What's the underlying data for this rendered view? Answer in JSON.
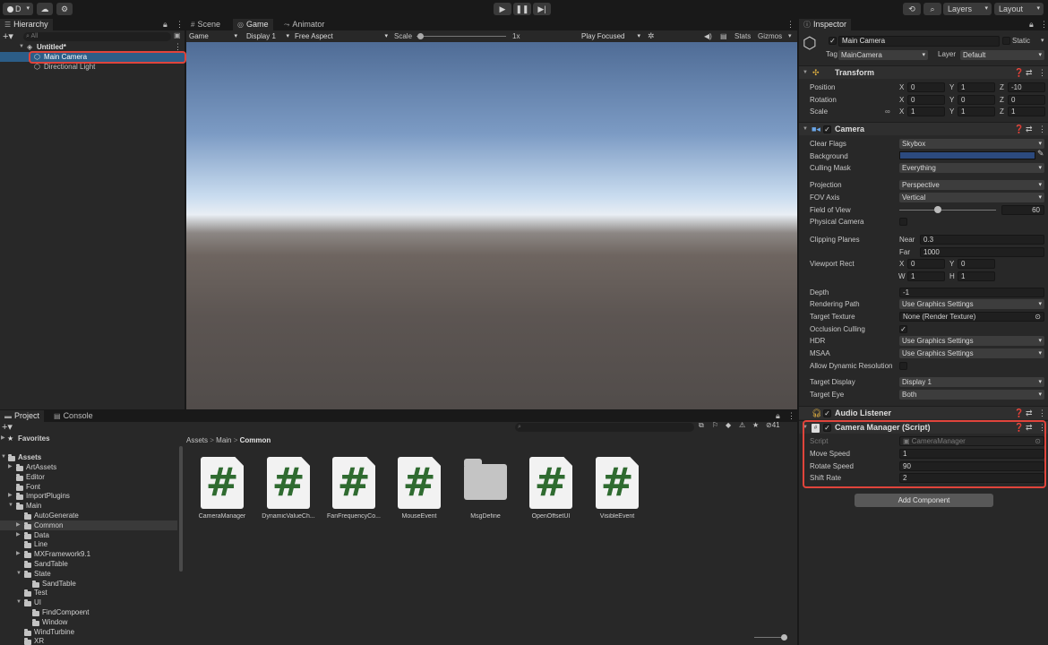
{
  "toolbar": {
    "account_label": "D",
    "layers_label": "Layers",
    "layout_label": "Layout"
  },
  "hierarchy": {
    "tab": "Hierarchy",
    "search_placeholder": "All",
    "scene_name": "Untitled*",
    "items": [
      "Main Camera",
      "Directional Light"
    ]
  },
  "view_tabs": [
    "Scene",
    "Game",
    "Animator"
  ],
  "game_bar": {
    "mode": "Game",
    "display": "Display 1",
    "aspect": "Free Aspect",
    "scale_label": "Scale",
    "scale_value": "1x",
    "play_mode": "Play Focused",
    "stats": "Stats",
    "gizmos": "Gizmos"
  },
  "inspector": {
    "tab": "Inspector",
    "object_name": "Main Camera",
    "static_label": "Static",
    "tag_label": "Tag",
    "tag_value": "MainCamera",
    "layer_label": "Layer",
    "layer_value": "Default",
    "transform": {
      "title": "Transform",
      "position_label": "Position",
      "position": [
        "0",
        "1",
        "-10"
      ],
      "rotation_label": "Rotation",
      "rotation": [
        "0",
        "0",
        "0"
      ],
      "scale_label": "Scale",
      "scale": [
        "1",
        "1",
        "1"
      ]
    },
    "camera": {
      "title": "Camera",
      "clear_flags_label": "Clear Flags",
      "clear_flags": "Skybox",
      "background_label": "Background",
      "background_color": "#2c4a7e",
      "culling_mask_label": "Culling Mask",
      "culling_mask": "Everything",
      "projection_label": "Projection",
      "projection": "Perspective",
      "fov_axis_label": "FOV Axis",
      "fov_axis": "Vertical",
      "fov_label": "Field of View",
      "fov": "60",
      "physical_camera_label": "Physical Camera",
      "clipping_label": "Clipping Planes",
      "near_label": "Near",
      "near": "0.3",
      "far_label": "Far",
      "far": "1000",
      "viewport_label": "Viewport Rect",
      "vp_x": "0",
      "vp_y": "0",
      "vp_w": "1",
      "vp_h": "1",
      "depth_label": "Depth",
      "depth": "-1",
      "rendering_path_label": "Rendering Path",
      "rendering_path": "Use Graphics Settings",
      "target_texture_label": "Target Texture",
      "target_texture": "None (Render Texture)",
      "occlusion_label": "Occlusion Culling",
      "hdr_label": "HDR",
      "hdr": "Use Graphics Settings",
      "msaa_label": "MSAA",
      "msaa": "Use Graphics Settings",
      "dyn_res_label": "Allow Dynamic Resolution",
      "target_display_label": "Target Display",
      "target_display": "Display 1",
      "target_eye_label": "Target Eye",
      "target_eye": "Both"
    },
    "audio_listener": {
      "title": "Audio Listener"
    },
    "camera_manager": {
      "title": "Camera Manager (Script)",
      "script_label": "Script",
      "script_value": "CameraManager",
      "move_speed_label": "Move Speed",
      "move_speed": "1",
      "rotate_speed_label": "Rotate Speed",
      "rotate_speed": "90",
      "shift_rate_label": "Shift Rate",
      "shift_rate": "2"
    },
    "add_component": "Add Component"
  },
  "project": {
    "tabs": [
      "Project",
      "Console"
    ],
    "favorites": "Favorites",
    "assets_root": "Assets",
    "tree": [
      "ArtAssets",
      "Editor",
      "Font",
      "ImportPlugins",
      "Main",
      "AutoGenerate",
      "Common",
      "Data",
      "Line",
      "MXFramework9.1",
      "SandTable",
      "State",
      "SandTable",
      "Test",
      "UI",
      "FindCompoent",
      "Window",
      "WindTurbine",
      "XR"
    ],
    "breadcrumb": [
      "Assets",
      "Main",
      "Common"
    ],
    "hidden_count": "41",
    "assets": [
      "CameraManager",
      "DynamicValueCh...",
      "FanFrequencyCo...",
      "MouseEvent",
      "MsgDefine",
      "OpenOffsetUI",
      "VisibleEvent"
    ]
  },
  "colors": {
    "accent_red": "#e0443b",
    "selection": "#2c5d87"
  }
}
